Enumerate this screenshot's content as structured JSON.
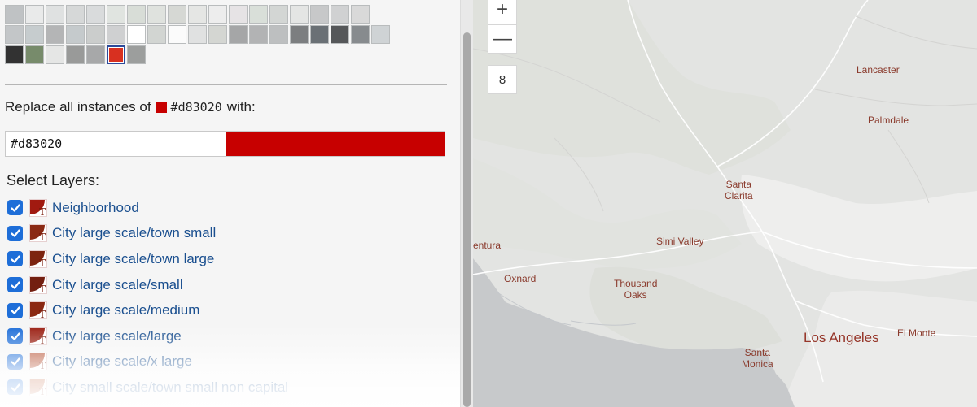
{
  "swatches": {
    "rows": [
      [
        "#bfc2c4",
        "#e9eaea",
        "#dfe1e1",
        "#d6d8d8",
        "#d9dbdc",
        "#e0e4e0",
        "#d8ddd7",
        "#dfe2de",
        "#d6d8d4",
        "#e5e6e4",
        "#ededed",
        "#e6e3e5",
        "#d9dfd9",
        "#d3d6d4",
        "#e4e5e4",
        "#c7c8c9",
        "#d0d1d2",
        "#d9d9d9"
      ],
      [
        "#c3c6c8",
        "#c6ccce",
        "#b4b5b6",
        "#c5cacc",
        "#cbcdcc",
        "#cfd0d1",
        "#ffffff",
        "#d2d5d2",
        "#fbfbfb",
        "#e0e1e1",
        "#d4d6d2",
        "#a5a6a7",
        "#b2b3b4",
        "#bdbfc0",
        "#7c7e80",
        "#6a7075",
        "#555759",
        "#878b8e",
        "#cfd3d5"
      ],
      [
        "#323232",
        "#778b6b",
        "#e5e6e5",
        "#999a99",
        "#a7a8a9",
        "#d83020",
        "#9c9e9d"
      ]
    ],
    "selected": {
      "row": 2,
      "index": 5
    }
  },
  "replace": {
    "prefix": "Replace all instances of",
    "from_hex": "#d83020",
    "suffix": "with:",
    "color": "#c70000"
  },
  "hex_input": {
    "value": "#d83020"
  },
  "layers_title": "Select Layers:",
  "layers": [
    {
      "label": "Neighborhood",
      "checked": true,
      "color": "#a11a10"
    },
    {
      "label": "City large scale/town small",
      "checked": true,
      "color": "#8a2a14"
    },
    {
      "label": "City large scale/town large",
      "checked": true,
      "color": "#7d2410"
    },
    {
      "label": "City large scale/small",
      "checked": true,
      "color": "#731f10"
    },
    {
      "label": "City large scale/medium",
      "checked": true,
      "color": "#8b2812"
    },
    {
      "label": "City large scale/large",
      "checked": true,
      "color": "#9a1f12"
    },
    {
      "label": "City large scale/x large",
      "checked": true,
      "color": "#b34a2a"
    },
    {
      "label": "City small scale/town small non capital",
      "checked": true,
      "color": "#c0603a"
    }
  ],
  "map": {
    "zoom_in_icon": "+",
    "zoom_out_icon": "—",
    "zoom_level": "8",
    "labels": {
      "lancaster": "Lancaster",
      "palmdale": "Palmdale",
      "santa_clarita_1": "Santa",
      "santa_clarita_2": "Clarita",
      "simi_valley": "Simi Valley",
      "ventura": "entura",
      "oxnard": "Oxnard",
      "thousand_oaks_1": "Thousand",
      "thousand_oaks_2": "Oaks",
      "los_angeles": "Los Angeles",
      "el_monte": "El Monte",
      "santa_monica_1": "Santa",
      "santa_monica_2": "Monica"
    }
  }
}
